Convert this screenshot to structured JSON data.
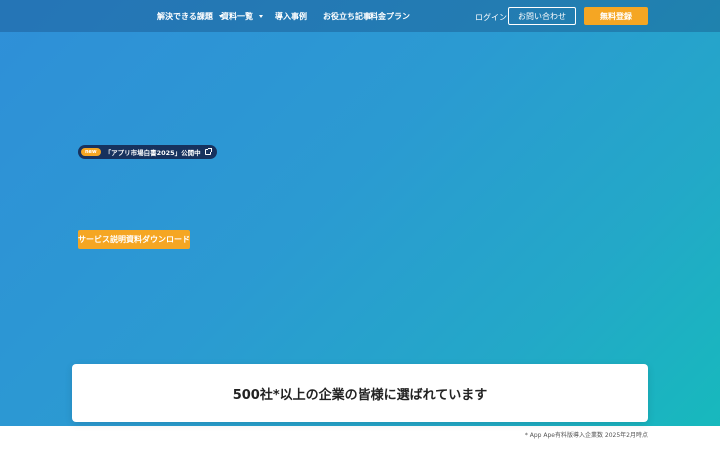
{
  "header": {
    "nav": [
      {
        "label": "解決できる課題",
        "has_dropdown": true
      },
      {
        "label": "資料一覧",
        "has_dropdown": true
      },
      {
        "label": "導入事例",
        "has_dropdown": false
      },
      {
        "label": "お役立ち記事",
        "has_dropdown": false
      },
      {
        "label": "料金プラン",
        "has_dropdown": false
      }
    ],
    "login_label": "ログイン",
    "contact_label": "お問い合わせ",
    "register_label": "無料登録"
  },
  "hero": {
    "badge_label": "new",
    "announcement": "「アプリ市場白書2025」公開中",
    "cta_label": "サービス説明資料ダウンロード"
  },
  "trust": {
    "title": "500社*以上の企業の皆様に選ばれています",
    "footnote": "* App Ape有料版導入企業数 2025年2月時点"
  },
  "colors": {
    "accent": "#f5a623",
    "pill_bg": "#17325e",
    "hero_start": "#2f8fd8",
    "hero_end": "#17b9bd"
  }
}
